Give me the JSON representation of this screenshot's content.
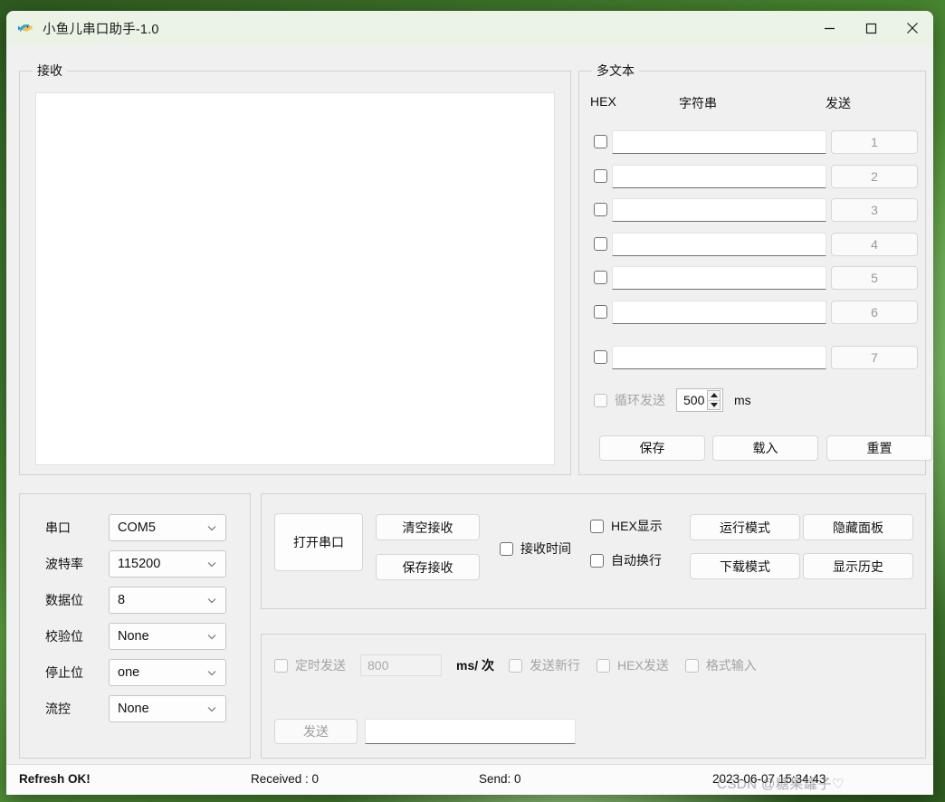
{
  "window": {
    "title": "小鱼儿串口助手-1.0",
    "icon": "tropical-fish-icon",
    "minimize": "−",
    "maximize": "□",
    "close": "✕"
  },
  "receive_group": {
    "label": "接收",
    "content": ""
  },
  "multitext_group": {
    "label": "多文本",
    "headers": {
      "hex": "HEX",
      "string": "字符串",
      "send": "发送"
    },
    "rows": [
      {
        "hex_checked": false,
        "text": "",
        "send_label": "1"
      },
      {
        "hex_checked": false,
        "text": "",
        "send_label": "2"
      },
      {
        "hex_checked": false,
        "text": "",
        "send_label": "3"
      },
      {
        "hex_checked": false,
        "text": "",
        "send_label": "4"
      },
      {
        "hex_checked": false,
        "text": "",
        "send_label": "5"
      },
      {
        "hex_checked": false,
        "text": "",
        "send_label": "6"
      },
      {
        "hex_checked": false,
        "text": "",
        "send_label": "7"
      }
    ],
    "cycle_send": {
      "label": "循环发送",
      "checked": false,
      "enabled": false,
      "interval": "500",
      "unit": "ms"
    },
    "buttons": {
      "save": "保存",
      "load": "载入",
      "reset": "重置"
    }
  },
  "serial_settings": {
    "fields": [
      {
        "label": "串口",
        "value": "COM5"
      },
      {
        "label": "波特率",
        "value": "115200"
      },
      {
        "label": "数据位",
        "value": "8"
      },
      {
        "label": "校验位",
        "value": "None"
      },
      {
        "label": "停止位",
        "value": "one"
      },
      {
        "label": "流控",
        "value": "None"
      }
    ]
  },
  "control_panel": {
    "open_port": "打开串口",
    "clear_recv": "清空接收",
    "save_recv": "保存接收",
    "recv_time": {
      "label": "接收时间",
      "checked": false
    },
    "hex_display": {
      "label": "HEX显示",
      "checked": false
    },
    "auto_newline": {
      "label": "自动换行",
      "checked": false
    },
    "run_mode": "运行模式",
    "hide_panel": "隐藏面板",
    "download_mode": "下载模式",
    "show_history": "显示历史"
  },
  "send_panel": {
    "timed_send": {
      "label": "定时发送",
      "checked": false,
      "enabled": false
    },
    "interval": "800",
    "interval_unit": "ms/ 次",
    "send_newline": {
      "label": "发送新行",
      "checked": false,
      "enabled": false
    },
    "hex_send": {
      "label": "HEX发送",
      "checked": false,
      "enabled": false
    },
    "format_input": {
      "label": "格式输入",
      "checked": false,
      "enabled": false
    },
    "send_button": "发送",
    "send_text": ""
  },
  "statusbar": {
    "refresh": "Refresh OK!",
    "received": "Received : 0",
    "sent": "Send: 0",
    "datetime": "2023-06-07 15:34:43"
  },
  "watermark": "CSDN @糖果罐子♡"
}
